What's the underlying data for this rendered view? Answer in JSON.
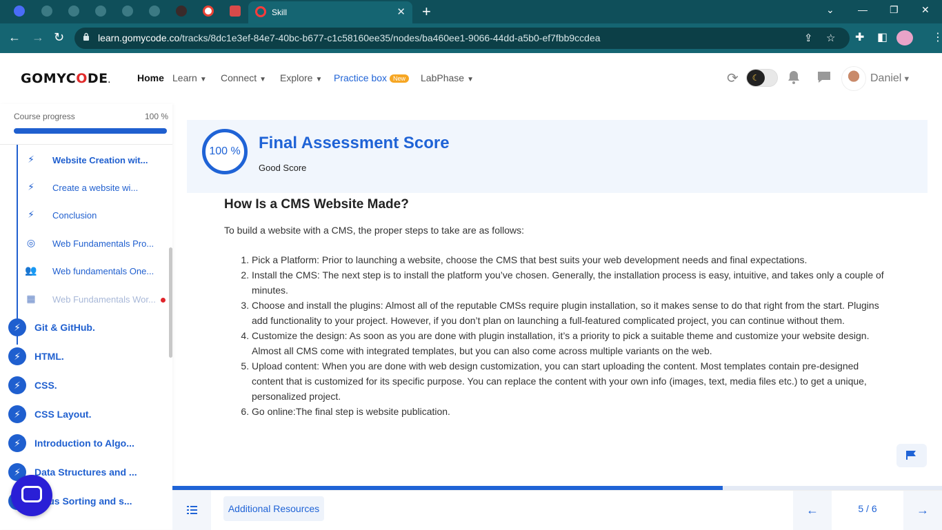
{
  "browser": {
    "active_tab_title": "Skill",
    "url_domain": "learn.gomycode.co",
    "url_path": "/tracks/8dc1e3ef-84e7-40bc-b677-c1c58160ee35/nodes/ba460ee1-9066-44dd-a5b0-ef7fbb9ccdea"
  },
  "header": {
    "logo": "GOMYCODE.",
    "nav": {
      "home": "Home",
      "learn": "Learn",
      "connect": "Connect",
      "explore": "Explore",
      "practice": "Practice box",
      "practice_badge": "New",
      "labphase": "LabPhase"
    },
    "username": "Daniel",
    "icons": [
      "refresh-icon",
      "moon-icon",
      "bell-icon",
      "chat-icon",
      "chevron-down-icon"
    ]
  },
  "sidebar": {
    "progress_label": "Course progress",
    "progress_value": "100 %",
    "progress_fraction": 1.0,
    "sub_items": [
      {
        "label": "Website Creation wit...",
        "icon": "bolt-icon"
      },
      {
        "label": "Create a website wi...",
        "icon": "bolt-icon"
      },
      {
        "label": "Conclusion",
        "icon": "bolt-icon"
      },
      {
        "label": "Web Fundamentals Pro...",
        "icon": "target-icon"
      },
      {
        "label": "Web fundamentals One...",
        "icon": "people-icon"
      },
      {
        "label": "Web Fundamentals Wor...",
        "icon": "workshop-icon"
      }
    ],
    "modules": [
      {
        "label": "Git & GitHub."
      },
      {
        "label": "HTML."
      },
      {
        "label": "CSS."
      },
      {
        "label": "CSS Layout."
      },
      {
        "label": "Introduction to Algo..."
      },
      {
        "label": "Data Structures and ..."
      },
      {
        "label": "...ous Sorting and s..."
      }
    ]
  },
  "score": {
    "value": "100 %",
    "title": "Final Assessment Score",
    "subtitle": "Good Score"
  },
  "article": {
    "heading": "How Is a CMS Website Made?",
    "intro": "To build a website with a CMS, the proper steps to take are as follows:",
    "steps": [
      "Pick a Platform: Prior to launching a website, choose the CMS that best suits your web development needs and final expectations.",
      "Install the CMS: The next step is to install the platform you’ve chosen. Generally, the installation process is easy, intuitive, and takes only a couple of minutes.",
      "Choose and install the plugins: Almost all of the reputable CMSs require plugin installation, so it makes sense to do that right from the start. Plugins add functionality to your project. However, if you don’t plan on launching a full-featured complicated project, you can continue without them.",
      "Customize the design: As soon as you are done with plugin installation, it’s a priority to pick a suitable theme and customize your website design. Almost all CMS come with integrated templates, but you can also come across multiple variants on the web.",
      "Upload content: When you are done with web design customization, you can start uploading the content. Most templates contain pre-designed content that is customized for its specific purpose. You can replace the content with your own info (images, text, media files etc.) to get a unique, personalized project.",
      "Go online:The final step is website publication."
    ]
  },
  "footer": {
    "resources_label": "Additional Resources",
    "pager": "5 / 6",
    "lesson_progress_fraction": 0.715
  },
  "colors": {
    "brand_blue": "#1f63d6",
    "browser_teal": "#156572",
    "badge_orange": "#f6a623"
  }
}
